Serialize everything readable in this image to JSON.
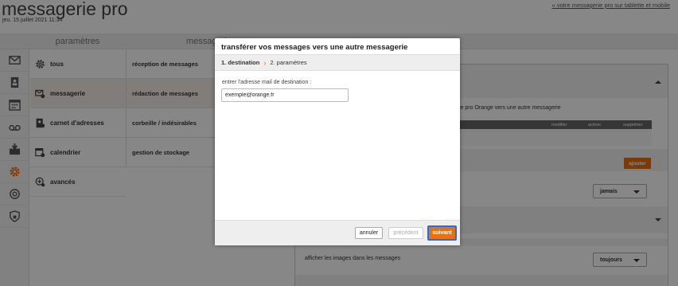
{
  "header": {
    "title": "messagerie pro",
    "date": "jeu. 15 juillet 2021 11:34",
    "link": "« votre messagerie pro sur tablette et mobile"
  },
  "columns": {
    "params_header": "paramètres",
    "messaging_header": "messagerie"
  },
  "sidebar": {
    "rail_icons": [
      "mail-icon",
      "contacts-icon",
      "calendar-icon",
      "voicemail-icon",
      "inbox-icon",
      "settings-gear-icon",
      "help-icon",
      "security-icon"
    ],
    "items": [
      {
        "label": "tous",
        "icon": "gear-icon"
      },
      {
        "label": "messagerie",
        "icon": "mail-gear-icon"
      },
      {
        "label": "carnet d'adresses",
        "icon": "address-book-icon"
      },
      {
        "label": "calendrier",
        "icon": "calendar-gear-icon"
      },
      {
        "label": "avancés",
        "icon": "advanced-plus-icon"
      }
    ]
  },
  "subnav": {
    "items": [
      {
        "label": "réception de messages"
      },
      {
        "label": "rédaction de messages"
      },
      {
        "label": "corbeille / indésirables"
      },
      {
        "label": "gestion de stockage"
      }
    ]
  },
  "content": {
    "description": "ie pro Orange vers une autre messagerie",
    "table_headers": [
      "modifier",
      "activer",
      "supprimer"
    ],
    "add_button": "ajouter",
    "dropdown1": "jamais",
    "images_label": "afficher les images dans les messages",
    "dropdown2": "toujours"
  },
  "modal": {
    "title": "transférer vos messages vers une autre messagerie",
    "step1": "1. destination",
    "step2": "2. paramètres",
    "field_label": "entrer l'adresse mail de destination :",
    "field_value": "exemple@orange.fr",
    "cancel": "annuler",
    "previous": "précédent",
    "next": "suivant"
  },
  "colors": {
    "accent": "#f16e00",
    "focus": "#2b6cd6"
  }
}
